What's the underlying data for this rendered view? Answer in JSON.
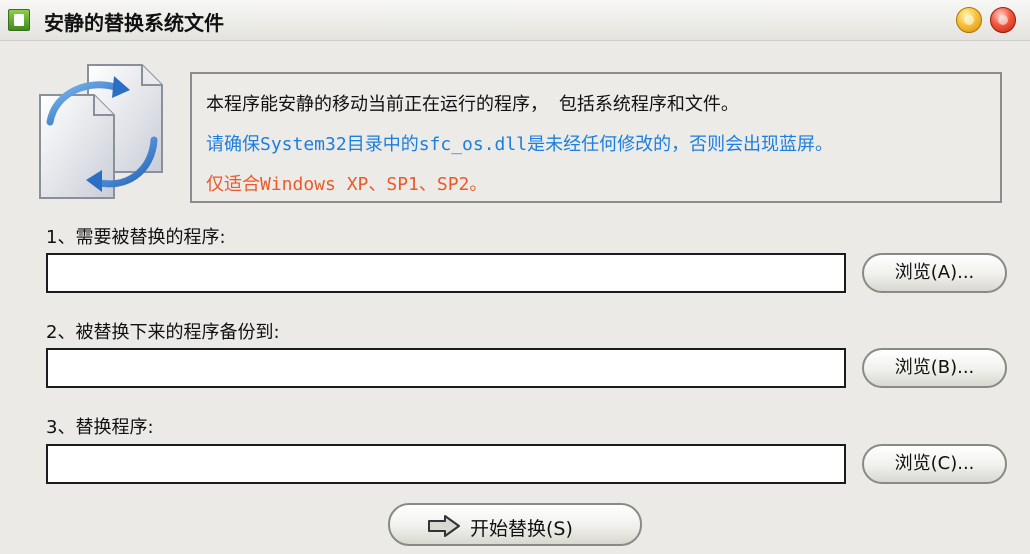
{
  "window": {
    "title": "安静的替换系统文件"
  },
  "info": {
    "line1": "本程序能安静的移动当前正在运行的程序， 包括系统程序和文件。",
    "line2": "请确保System32目录中的sfc_os.dll是未经任何修改的，否则会出现蓝屏。",
    "line3": "仅适合Windows XP、SP1、SP2。",
    "colors": {
      "line1": "#111111",
      "line2": "#1a7fe0",
      "line3": "#ec5a2a"
    }
  },
  "fields": [
    {
      "label": "1、需要被替换的程序:",
      "value": "",
      "browse_label": "浏览(A)..."
    },
    {
      "label": "2、被替换下来的程序备份到:",
      "value": "",
      "browse_label": "浏览(B)..."
    },
    {
      "label": "3、替换程序:",
      "value": "",
      "browse_label": "浏览(C)..."
    }
  ],
  "actions": {
    "start_label": "开始替换(S)"
  },
  "icons": {
    "app": "app-icon",
    "logo": "file-sync-icon",
    "start": "arrow-right-icon",
    "minimize": "minimize-icon",
    "close": "close-icon"
  }
}
